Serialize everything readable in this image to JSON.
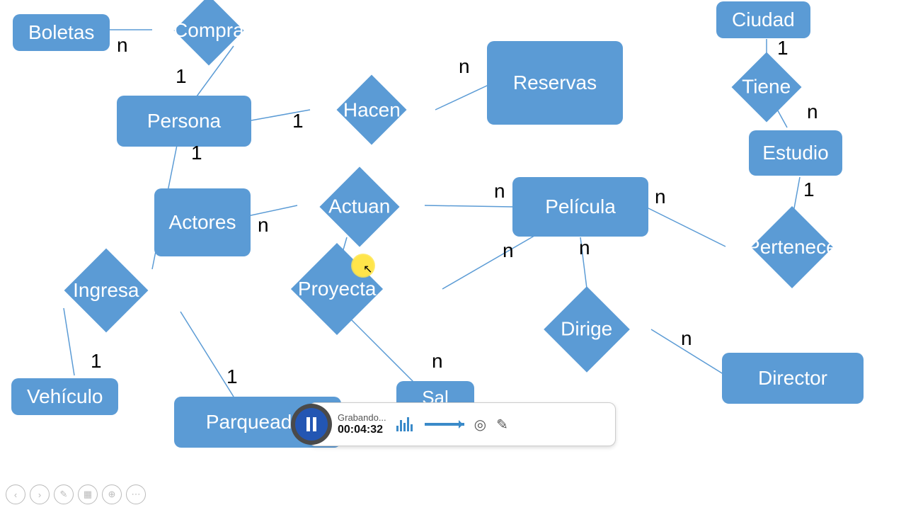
{
  "entities": {
    "boletas": "Boletas",
    "persona": "Persona",
    "reservas": "Reservas",
    "ciudad": "Ciudad",
    "estudio": "Estudio",
    "actores": "Actores",
    "pelicula": "Película",
    "vehiculo": "Vehículo",
    "parqueadero": "Parqueader",
    "director": "Director",
    "sala": "Sal"
  },
  "relations": {
    "compra": "Compra",
    "hacen": "Hacen",
    "tiene": "Tiene",
    "actuan": "Actuan",
    "pertenece": "Pertenece",
    "proyecta": "Proyecta",
    "ingresa": "Ingresa",
    "dirige": "Dirige"
  },
  "cards": {
    "c1": "n",
    "c2": "1",
    "c3": "1",
    "c4": "1",
    "c5": "n",
    "c6": "1",
    "c7": "n",
    "c8": "1",
    "c9": "n",
    "c10": "n",
    "c11": "n",
    "c12": "n",
    "c13": "n",
    "c14": "1",
    "c15": "1",
    "c16": "n"
  },
  "recorder": {
    "status": "Grabando...",
    "time": "00:04:32"
  }
}
